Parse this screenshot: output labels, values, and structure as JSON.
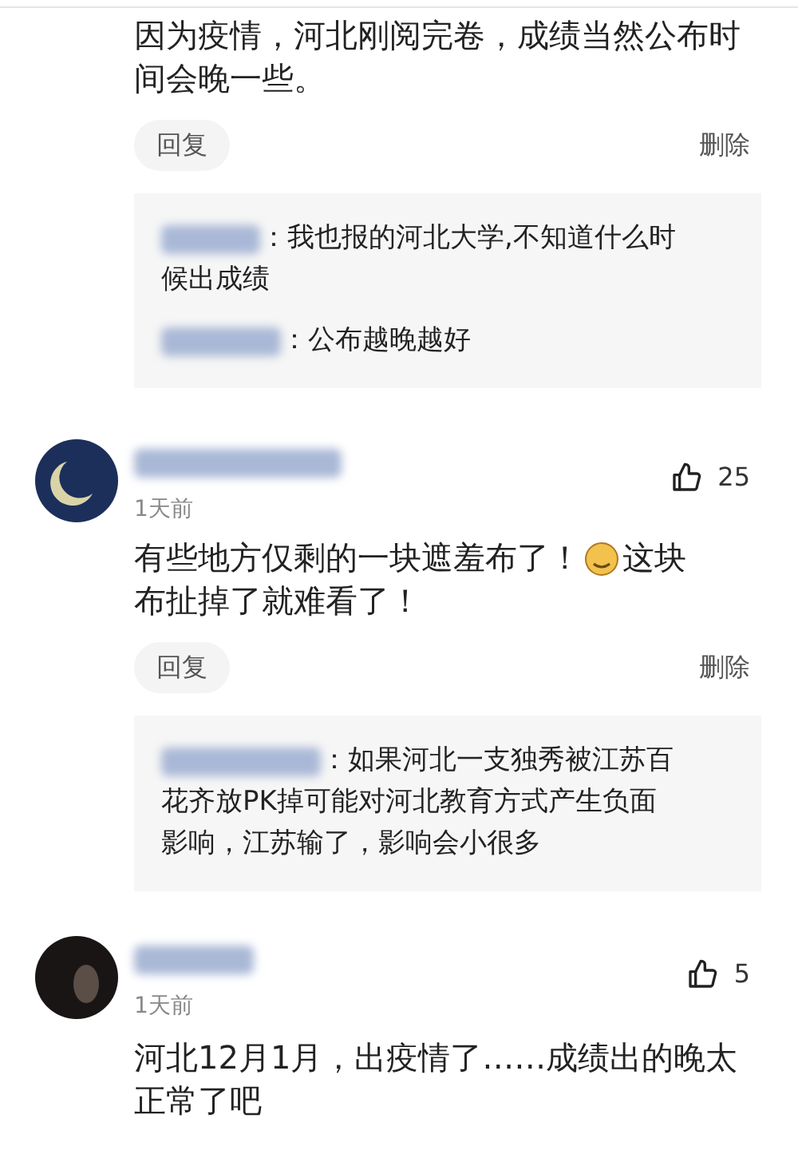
{
  "comments": [
    {
      "text": "因为疫情，河北刚阅完卷，成绩当然公布时间会晚一些。",
      "reply_label": "回复",
      "delete_label": "删除",
      "replies": [
        {
          "lines": [
            "：我也报的河北大学,不知道什么时",
            "候出成绩"
          ]
        },
        {
          "lines": [
            "：公布越晚越好"
          ]
        }
      ]
    },
    {
      "time": "1天前",
      "likes": "25",
      "text_before": "有些地方仅剩的一块遮羞布了！",
      "text_after": [
        "这块",
        "布扯掉了就难看了！"
      ],
      "reply_label": "回复",
      "delete_label": "删除",
      "replies": [
        {
          "lines": [
            "：如果河北一支独秀被江苏百",
            "花齐放PK掉可能对河北教育方式产生负面",
            "影响，江苏输了，影响会小很多"
          ]
        }
      ]
    },
    {
      "time": "1天前",
      "likes": "5",
      "text": "河北12月1月，出疫情了……成绩出的晚太正常了吧"
    }
  ]
}
